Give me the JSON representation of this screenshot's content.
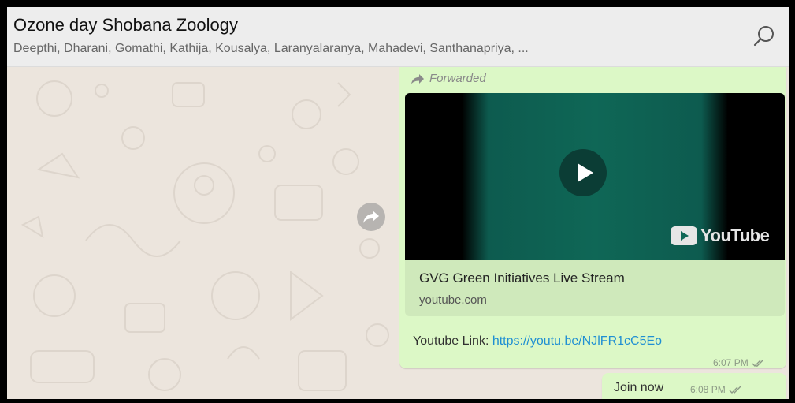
{
  "header": {
    "title": "Ozone day Shobana Zoology",
    "members": "Deepthi, Dharani, Gomathi, Kathija, Kousalya, Laranyalaranya, Mahadevi, Santhanapriya, ...",
    "search_icon": "search-icon"
  },
  "message": {
    "forwarded_label": "Forwarded",
    "preview": {
      "thumbnail_brand": "YouTube",
      "title": "GVG Green Initiatives Live Stream",
      "domain": "youtube.com"
    },
    "text_prefix": "Youtube Link: ",
    "link": "https://youtu.be/NJlFR1cC5Eo",
    "time": "6:07 PM"
  },
  "reply": {
    "text": "Join now",
    "time": "6:08 PM"
  },
  "colors": {
    "bubble": "#dcf8c6",
    "link": "#1f8fd3",
    "header_bg": "#ededed",
    "chat_bg": "#ece5dd"
  }
}
